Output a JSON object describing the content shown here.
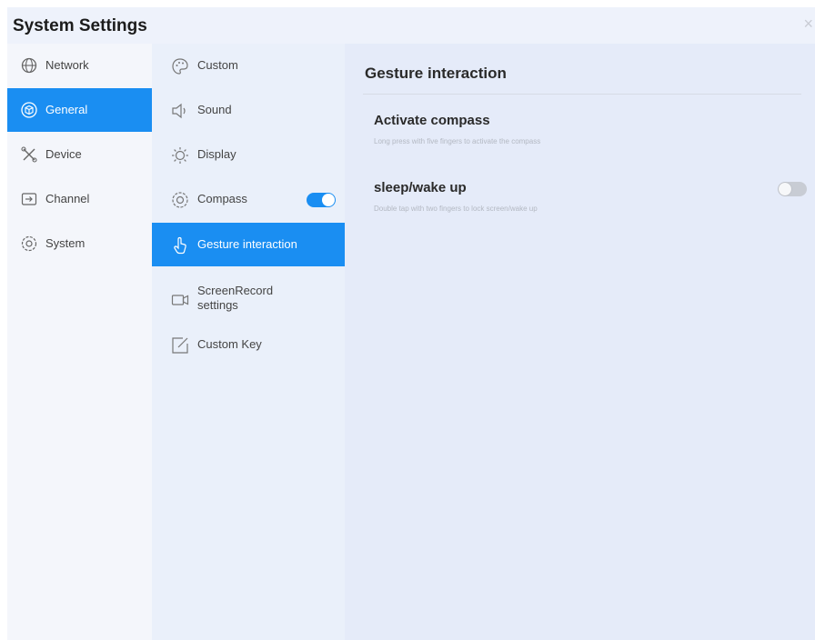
{
  "window": {
    "title": "System Settings",
    "close_glyph": "×"
  },
  "categories": [
    {
      "label": "Network",
      "icon": "globe-icon",
      "active": false
    },
    {
      "label": "General",
      "icon": "cube-icon",
      "active": true
    },
    {
      "label": "Device",
      "icon": "tools-icon",
      "active": false
    },
    {
      "label": "Channel",
      "icon": "input-icon",
      "active": false
    },
    {
      "label": "System",
      "icon": "gear-icon",
      "active": false
    }
  ],
  "general_menu": [
    {
      "label": "Custom",
      "icon": "palette-icon",
      "active": false
    },
    {
      "label": "Sound",
      "icon": "speaker-icon",
      "active": false
    },
    {
      "label": "Display",
      "icon": "sun-icon",
      "active": false
    },
    {
      "label": "Compass",
      "icon": "compass-icon",
      "active": false,
      "toggle": true
    },
    {
      "label": "Gesture interaction",
      "icon": "hand-icon",
      "active": true
    },
    {
      "label": "ScreenRecord settings",
      "icon": "camera-icon",
      "active": false
    },
    {
      "label": "Custom Key",
      "icon": "edit-icon",
      "active": false
    }
  ],
  "panel": {
    "title": "Gesture interaction",
    "settings": [
      {
        "title": "Activate compass",
        "description": "Long press with five fingers to activate the compass",
        "has_toggle": false
      },
      {
        "title": "sleep/wake up",
        "description": "Double tap with two fingers to lock screen/wake up",
        "has_toggle": true,
        "toggle_on": false
      }
    ]
  },
  "colors": {
    "accent": "#1a8ef2",
    "background": "#e5ebf9"
  }
}
